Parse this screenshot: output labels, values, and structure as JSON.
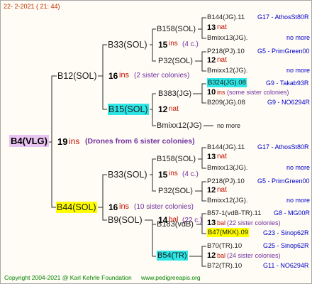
{
  "header": {
    "date": "22-  2-2021 ( 21: 44)"
  },
  "footer": {
    "copyright": "Copyright 2004-2021 @ Karl Kehrle Foundation",
    "url": "www.pedigreeapis.org"
  },
  "root": {
    "id": "B4(VLG)",
    "count": "19",
    "unit": "ins",
    "note": "(Drones from 6 sister colonies)"
  },
  "gen1": [
    {
      "id": "B12(SOL)",
      "count": "16",
      "unit": "ins",
      "note": "(2 sister colonies)"
    },
    {
      "id": "B44(SOL)",
      "count": "16",
      "unit": "ins",
      "note": "(10 sister colonies)"
    }
  ],
  "gen2": [
    {
      "id": "B33(SOL)",
      "count": "15",
      "unit": "ins",
      "note": "(4 c.)"
    },
    {
      "id": "B15(SOL)",
      "count": "12",
      "unit": "nat",
      "note": ""
    },
    {
      "id": "B33(SOL)",
      "count": "15",
      "unit": "ins",
      "note": "(4 c.)"
    },
    {
      "id": "B9(SOL)",
      "count": "14",
      "unit": "bal",
      "note": "(22 c.)"
    }
  ],
  "gen3": [
    {
      "id": "B158(SOL)",
      "count": "13",
      "unit": "nat",
      "note": ""
    },
    {
      "id": "P32(SOL)",
      "count": "12",
      "unit": "nat",
      "note": ""
    },
    {
      "id": "B383(JG)",
      "count": "10",
      "unit": "ins",
      "note": "(some sister colonies)"
    },
    {
      "id": "Bmixx12(JG)",
      "count": "",
      "unit": "",
      "note": ""
    },
    {
      "id": "B158(SOL)",
      "count": "13",
      "unit": "nat",
      "note": ""
    },
    {
      "id": "P32(SOL)",
      "count": "12",
      "unit": "nat",
      "note": ""
    },
    {
      "id": "B183(vdB)",
      "count": "13",
      "unit": "bal",
      "note": "(22 sister colonies)"
    },
    {
      "id": "B54(TR)",
      "count": "12",
      "unit": "bal",
      "note": "(24 sister colonies)"
    }
  ],
  "gen4": [
    {
      "id": "B144(JG).11",
      "code": "G17 - AthosSt80R"
    },
    {
      "id": "Bmixx13(JG).",
      "code": "no more"
    },
    {
      "id": "P218(PJ).10",
      "code": "G5 - PrimGreen00"
    },
    {
      "id": "Bmixx12(JG).",
      "code": "no more"
    },
    {
      "id": "B324(JG).08",
      "code": "G9 - Takab93R"
    },
    {
      "id": "B209(JG).08",
      "code": "G9 - NO6294R"
    },
    {
      "id": "no more",
      "code": ""
    },
    {
      "id": "B144(JG).11",
      "code": "G17 - AthosSt80R"
    },
    {
      "id": "Bmixx13(JG).",
      "code": "no more"
    },
    {
      "id": "P218(PJ).10",
      "code": "G5 - PrimGreen00"
    },
    {
      "id": "Bmixx12(JG).",
      "code": "no more"
    },
    {
      "id": "B57-1(vdB-TR).11",
      "code": "G8 - MG00R"
    },
    {
      "id": "B47(MKK).09",
      "code": "G23 - Sinop62R"
    },
    {
      "id": "B70(TR).10",
      "code": "G25 - Sinop62R"
    },
    {
      "id": "B72(TR).10",
      "code": "G11 - NO6294R"
    }
  ],
  "colors": {
    "unit": "#c01000",
    "note": "#7030a0",
    "code": "#0000c8",
    "highlight_yellow": "#ffff00",
    "highlight_cyan": "#2ee6e6",
    "highlight_pink": "#e9c4f2",
    "footer": "#008000"
  }
}
